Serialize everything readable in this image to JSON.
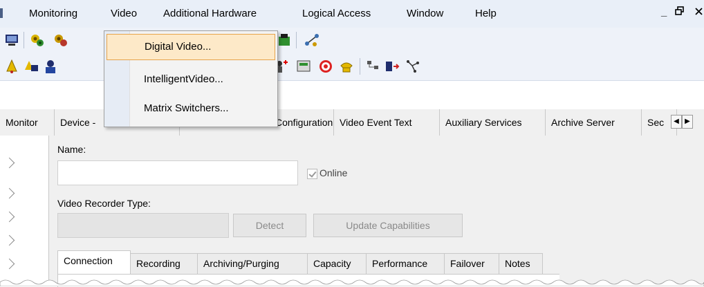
{
  "menubar": {
    "items": [
      "Monitoring",
      "Video",
      "Additional Hardware",
      "Logical Access",
      "Window",
      "Help"
    ],
    "window_controls": {
      "minimize": "_",
      "restore": "ƈ"
    }
  },
  "dropdown": {
    "items": [
      "Digital Video...",
      "IntelligentVideo...",
      "Matrix Switchers..."
    ]
  },
  "tabs": {
    "items": [
      "Monitor",
      "Device -",
      "Configuration",
      "Video Event Text",
      "Auxiliary Services",
      "Archive Server",
      "Sec"
    ]
  },
  "form": {
    "name_label": "Name:",
    "name_value": "",
    "online_label": "Online",
    "recorder_type_label": "Video Recorder Type:",
    "recorder_type_value": "",
    "detect_button": "Detect",
    "update_capabilities_button": "Update Capabilities"
  },
  "inner_tabs": {
    "items": [
      "Connection",
      "Recording",
      "Archiving/Purging",
      "Capacity",
      "Performance",
      "Failover",
      "Notes"
    ],
    "active": "Connection"
  },
  "colors": {
    "menubar_bg": "#e9eff8",
    "dropdown_highlight": "#fde9c8",
    "dropdown_highlight_border": "#e6a34a"
  }
}
